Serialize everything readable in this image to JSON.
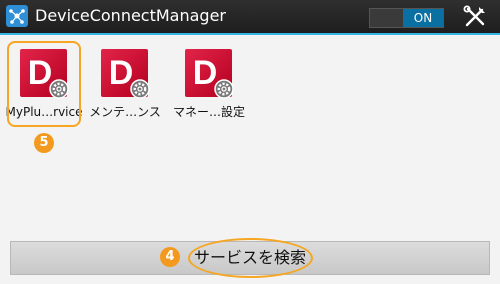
{
  "app_bar": {
    "title": "DeviceConnectManager",
    "toggle_label": "ON",
    "app_icon": "device-connect-app-icon",
    "tools_icon": "tools-icon"
  },
  "plugins": [
    {
      "letter": "D",
      "label": "MyPlu…rvice",
      "icon": "plugin-d-icon"
    },
    {
      "letter": "D",
      "label": "メンテ…ンス",
      "icon": "plugin-d-icon"
    },
    {
      "letter": "D",
      "label": "マネー…設定",
      "icon": "plugin-d-icon"
    }
  ],
  "search_button": {
    "label": "サービスを検索"
  },
  "annotations": {
    "badge_plugin": "5",
    "badge_search": "4"
  },
  "colors": {
    "accent": "#33b5e5",
    "plugin_red": "#d4143a",
    "highlight_orange": "#f5a623",
    "toggle_on": "#0a6fa1"
  }
}
